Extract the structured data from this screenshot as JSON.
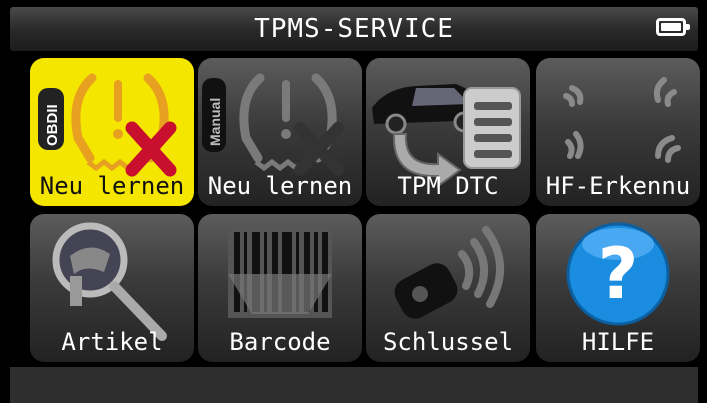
{
  "header": {
    "title": "TPMS-SERVICE",
    "battery_icon": "battery-full-icon"
  },
  "tiles": [
    {
      "label": "Neu lernen",
      "icon": "obdii-tpms-relearn-icon",
      "badge": "OBDII",
      "selected": true
    },
    {
      "label": "Neu lernen",
      "icon": "manual-tpms-relearn-icon",
      "badge": "Manual",
      "selected": false
    },
    {
      "label": "TPM DTC",
      "icon": "car-dtc-list-icon",
      "selected": false
    },
    {
      "label": "HF-Erkennu",
      "icon": "rf-signal-icon",
      "selected": false
    },
    {
      "label": "Artikel",
      "icon": "magnifier-sensor-icon",
      "selected": false
    },
    {
      "label": "Barcode",
      "icon": "barcode-icon",
      "selected": false
    },
    {
      "label": "Schlussel",
      "icon": "key-fob-icon",
      "selected": false
    },
    {
      "label": "HILFE",
      "icon": "help-question-icon",
      "selected": false
    }
  ],
  "colors": {
    "selected_tile": "#f5e600",
    "tile_dark": "#3b3b3b",
    "help_blue": "#1a8de0",
    "error_red": "#c8102e",
    "tpms_orange": "#e8a020"
  }
}
